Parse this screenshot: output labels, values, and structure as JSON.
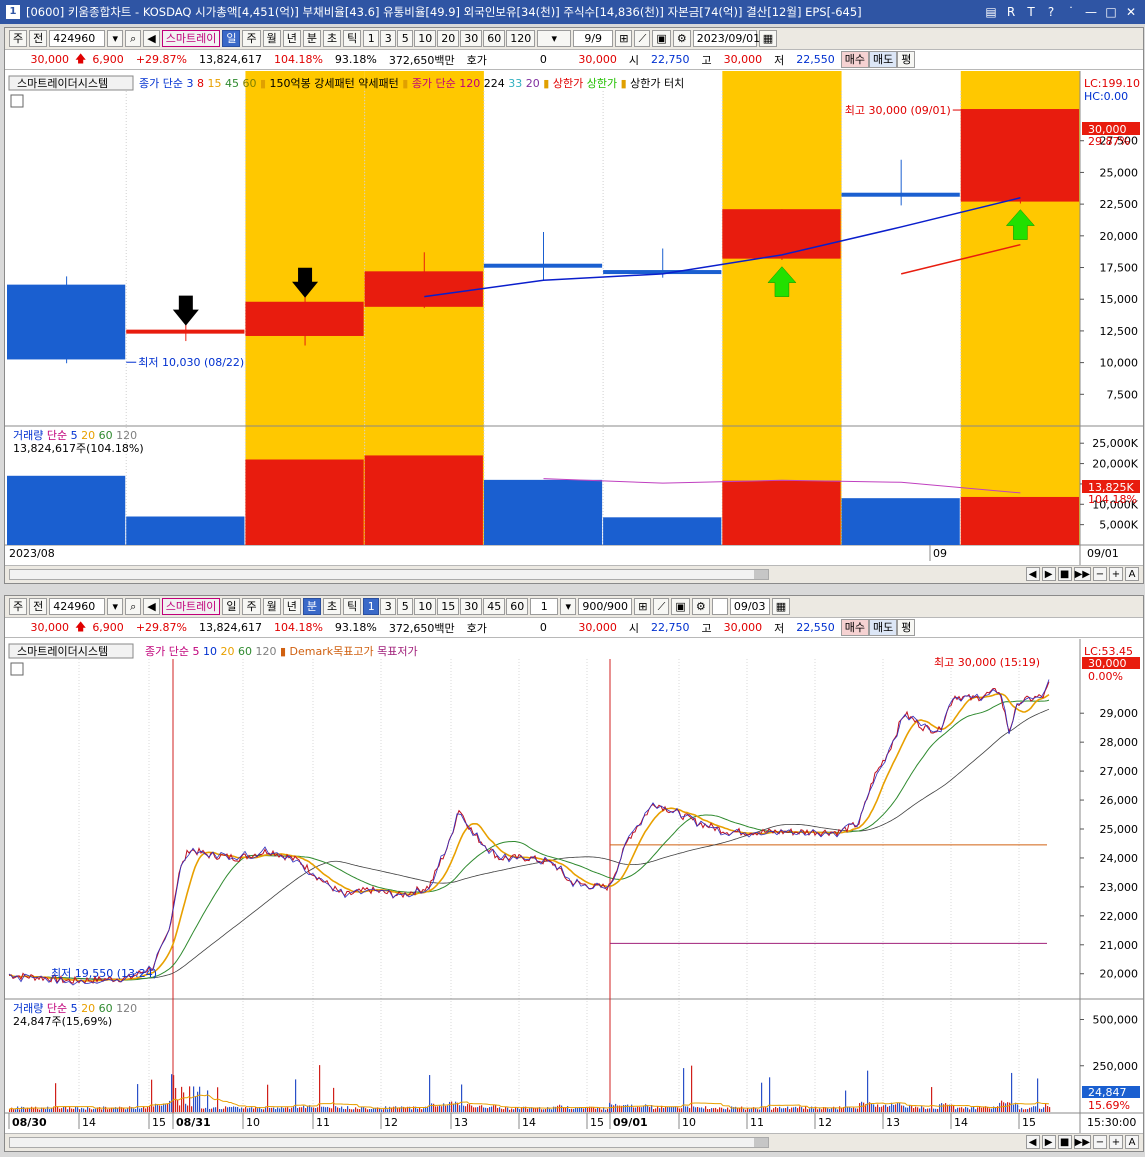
{
  "title": {
    "window_number": "1",
    "text": "[0600] 키움종합차트 - KOSDAQ 시가총액[4,451(억)] 부채비율[43.6] 유통비율[49.9] 외국인보유[34(천)] 주식수[14,836(천)] 자본금[74(억)] 결산[12월] EPS[-645]",
    "controls": [
      "▤",
      "R",
      "T",
      "?",
      "˙",
      "—",
      "□",
      "✕"
    ]
  },
  "top": {
    "toolbar": {
      "type_btn": "주",
      "prev_btn": "전",
      "code": "424960",
      "strategy": "스마트레이",
      "periods": [
        "일",
        "주",
        "월",
        "년"
      ],
      "intraday": [
        "분",
        "초",
        "틱"
      ],
      "nums": [
        "1",
        "3",
        "5",
        "10",
        "20",
        "30",
        "60",
        "120"
      ],
      "count": "9/9",
      "date": "2023/09/01"
    },
    "quote": {
      "price": "30,000",
      "change": "6,900",
      "rate": "+29.87%",
      "volume": "13,824,617",
      "vol_rate": "104.18%",
      "turnover": "93.18%",
      "amount": "372,650백만",
      "hoga_label": "호가",
      "hoga": "0",
      "hoga_price": "30,000",
      "open_label": "시",
      "open": "22,750",
      "high_label": "고",
      "high": "30,000",
      "low_label": "저",
      "low": "22,550",
      "buy": "매수",
      "sell": "매도",
      "flat": "평"
    },
    "legend": {
      "system": "스마트레이더시스템",
      "ma_label": "종가 단순",
      "ma_periods": [
        "3",
        "8",
        "15",
        "45",
        "60"
      ],
      "strong": "150억봉 강세패턴",
      "weak": "약세패턴",
      "ma2_label": "종가 단순",
      "ma2_periods": [
        "120",
        "224",
        "33",
        "20"
      ],
      "upper1": "상한가",
      "upper2": "상한가",
      "upper_touch": "상한가 터치"
    },
    "lc": "LC:199.10",
    "hc": "HC:0.00",
    "max_label": "최고 30,000 (09/01)",
    "min_label": "최저 10,030 (08/22)",
    "price_right": "30,000",
    "pct_right": "29.87%",
    "price_axis": [
      "27,500",
      "25,000",
      "22,500",
      "20,000",
      "17,500",
      "15,000",
      "12,500",
      "10,000",
      "7,500"
    ],
    "volume_legend": {
      "label": "거래량",
      "ma_label": "단순",
      "periods": [
        "5",
        "20",
        "60",
        "120"
      ],
      "current": "13,824,617주(104.18%)"
    },
    "vol_axis": [
      "25,000K",
      "20,000K",
      "15,000K",
      "10,000K",
      "5,000K"
    ],
    "vol_right": "13,825K",
    "vol_pct": "104.18%",
    "date_left": "2023/08",
    "date_mid": "09",
    "date_right": "09/01"
  },
  "top_chart": {
    "candles": [
      {
        "o": 16150,
        "h": 16800,
        "l": 9950,
        "c": 10250,
        "color": "blue"
      },
      {
        "o": 12300,
        "h": 13400,
        "l": 11700,
        "c": 12600,
        "color": "red"
      },
      {
        "o": 12100,
        "h": 16500,
        "l": 11350,
        "c": 14800,
        "color": "red"
      },
      {
        "o": 14400,
        "h": 18700,
        "l": 14300,
        "c": 17200,
        "color": "red"
      },
      {
        "o": 17800,
        "h": 20300,
        "l": 16500,
        "c": 17600,
        "color": "blue"
      },
      {
        "o": 17300,
        "h": 19000,
        "l": 16700,
        "c": 17000,
        "color": "blue"
      },
      {
        "o": 18200,
        "h": 22100,
        "l": 18100,
        "c": 22100,
        "color": "red"
      },
      {
        "o": 23400,
        "h": 26000,
        "l": 22400,
        "c": 23100,
        "color": "blue"
      },
      {
        "o": 22700,
        "h": 30000,
        "l": 22550,
        "c": 30000,
        "color": "red"
      }
    ],
    "volumes": [
      {
        "v": 17000,
        "color": "blue"
      },
      {
        "v": 7000,
        "color": "blue"
      },
      {
        "v": 21000,
        "color": "red"
      },
      {
        "v": 22000,
        "color": "red"
      },
      {
        "v": 16000,
        "color": "blue"
      },
      {
        "v": 6800,
        "color": "blue"
      },
      {
        "v": 15800,
        "color": "red"
      },
      {
        "v": 11500,
        "color": "blue"
      },
      {
        "v": 11800,
        "color": "red"
      }
    ],
    "highlight_days": [
      2,
      3,
      6,
      8
    ],
    "ma_line": [
      null,
      null,
      null,
      15200,
      16500,
      17000,
      18500,
      20700,
      23000
    ],
    "vol_ma": [
      null,
      null,
      null,
      null,
      16300,
      15200,
      15900,
      15400,
      12800
    ],
    "down_arrows": [
      1,
      2
    ],
    "up_arrows": [
      6,
      8
    ],
    "y_min": 5000,
    "y_max": 33000
  },
  "bottom": {
    "toolbar": {
      "type_btn": "주",
      "prev_btn": "전",
      "code": "424960",
      "strategy": "스마트레이",
      "periods": [
        "일",
        "주",
        "월",
        "년"
      ],
      "intraday": [
        "분",
        "초",
        "틱"
      ],
      "nums": [
        "1",
        "3",
        "5",
        "10",
        "15",
        "30",
        "45",
        "60"
      ],
      "tick": "1",
      "count": "900/900",
      "date": "09/03"
    },
    "legend": {
      "system": "스마트레이더시스템",
      "ma_label": "종가 단순",
      "ma_periods": [
        "5",
        "10",
        "20",
        "60",
        "120"
      ],
      "demark_high": "Demark목표고가",
      "demark_low": "목표저가"
    },
    "lc": "LC:53.45",
    "max_label": "최고 30,000 (15:19)",
    "min_label": "최저 19,550 (13:24)",
    "price_right": "30,000",
    "pct_right": "0.00%",
    "price_axis": [
      "29,000",
      "28,000",
      "27,000",
      "26,000",
      "25,000",
      "24,000",
      "23,000",
      "22,000",
      "21,000",
      "20,000"
    ],
    "volume_legend": {
      "label": "거래량",
      "ma_label": "단순",
      "periods": [
        "5",
        "20",
        "60",
        "120"
      ],
      "current": "24,847주(15,69%)"
    },
    "vol_axis": [
      "500,000",
      "250,000"
    ],
    "vol_right": "24,847",
    "vol_pct": "15.69%",
    "time_labels": [
      "08/30",
      "14",
      "15",
      "08/31",
      "10",
      "11",
      "12",
      "13",
      "14",
      "15",
      "09/01",
      "10",
      "11",
      "12",
      "13",
      "14",
      "15"
    ],
    "time_right": "15:30:00"
  },
  "bottom_chart": {
    "anchors": [
      [
        0,
        19950
      ],
      [
        40,
        19850
      ],
      [
        60,
        19750
      ],
      [
        120,
        19850
      ],
      [
        145,
        20250
      ],
      [
        160,
        21500
      ],
      [
        170,
        23500
      ],
      [
        180,
        24300
      ],
      [
        200,
        24100
      ],
      [
        230,
        24000
      ],
      [
        260,
        24250
      ],
      [
        290,
        23900
      ],
      [
        310,
        23300
      ],
      [
        335,
        22700
      ],
      [
        360,
        22900
      ],
      [
        390,
        22700
      ],
      [
        420,
        23000
      ],
      [
        440,
        24500
      ],
      [
        450,
        25700
      ],
      [
        465,
        24800
      ],
      [
        490,
        24000
      ],
      [
        520,
        24000
      ],
      [
        545,
        23800
      ],
      [
        560,
        23200
      ],
      [
        585,
        23000
      ],
      [
        600,
        23000
      ],
      [
        620,
        24700
      ],
      [
        645,
        25900
      ],
      [
        665,
        25600
      ],
      [
        690,
        25200
      ],
      [
        720,
        24900
      ],
      [
        760,
        24900
      ],
      [
        800,
        24900
      ],
      [
        830,
        24900
      ],
      [
        850,
        25200
      ],
      [
        865,
        26800
      ],
      [
        880,
        27700
      ],
      [
        895,
        29000
      ],
      [
        915,
        28500
      ],
      [
        930,
        28400
      ],
      [
        945,
        29600
      ],
      [
        965,
        29500
      ],
      [
        990,
        29800
      ],
      [
        1000,
        28400
      ],
      [
        1010,
        29400
      ],
      [
        1035,
        29600
      ],
      [
        1040,
        30000
      ]
    ],
    "demark_high": 24450,
    "demark_low": 21050,
    "y_min": 19300,
    "y_max": 30700
  },
  "colors": {
    "bull": "#e81c0e",
    "bear": "#1a5fd0",
    "highlight": "#ffc800",
    "ma": "#0a1ecc",
    "ma_red": "#e81c0e",
    "vol_ma": "#c040c0",
    "arrow_green": "#22e000",
    "arrow_black": "#000000"
  }
}
